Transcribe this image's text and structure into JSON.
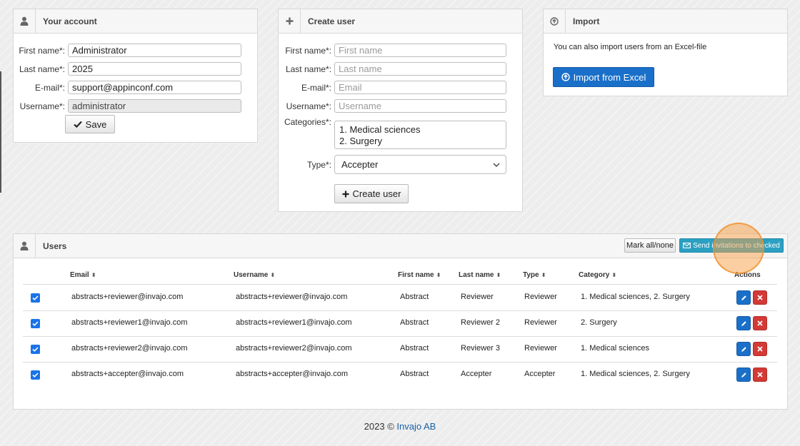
{
  "account": {
    "title": "Your account",
    "icon": "user-icon",
    "fields": [
      {
        "label": "First name*:",
        "value": "Administrator"
      },
      {
        "label": "Last name*:",
        "value": "2025"
      },
      {
        "label": "E-mail*:",
        "value": "support@appinconf.com"
      },
      {
        "label": "Username*:",
        "value": "administrator"
      }
    ],
    "save_label": "Save"
  },
  "create_user": {
    "title": "Create user",
    "icon": "plus-icon",
    "fields": [
      {
        "label": "First name*:",
        "placeholder": "First name"
      },
      {
        "label": "Last name*:",
        "placeholder": "Last name"
      },
      {
        "label": "E-mail*:",
        "placeholder": "Email"
      },
      {
        "label": "Username*:",
        "placeholder": "Username"
      }
    ],
    "categories_label": "Categories*:",
    "categories": [
      "1. Medical sciences",
      "2. Surgery"
    ],
    "type_label": "Type*:",
    "type_value": "Accepter",
    "button_label": "Create user"
  },
  "import": {
    "title": "Import",
    "icon": "upload-circle-icon",
    "text": "You can also import users from an Excel-file",
    "button_label": "Import from Excel"
  },
  "users": {
    "title": "Users",
    "icon": "user-icon",
    "mark_all_label": "Mark all/none",
    "send_label": "Send invitations to checked",
    "columns": {
      "email": "Email",
      "username": "Username",
      "first_name": "First name",
      "last_name": "Last name",
      "type": "Type",
      "category": "Category",
      "actions": "Actions"
    },
    "rows": [
      {
        "email": "abstracts+reviewer@invajo.com",
        "username": "abstracts+reviewer@invajo.com",
        "first_name": "Abstract",
        "last_name": "Reviewer",
        "type": "Reviewer",
        "category": "1. Medical sciences, 2. Surgery",
        "checked": true
      },
      {
        "email": "abstracts+reviewer1@invajo.com",
        "username": "abstracts+reviewer1@invajo.com",
        "first_name": "Abstract",
        "last_name": "Reviewer 2",
        "type": "Reviewer",
        "category": "2. Surgery",
        "checked": true
      },
      {
        "email": "abstracts+reviewer2@invajo.com",
        "username": "abstracts+reviewer2@invajo.com",
        "first_name": "Abstract",
        "last_name": "Reviewer 3",
        "type": "Reviewer",
        "category": "1. Medical sciences",
        "checked": true
      },
      {
        "email": "abstracts+accepter@invajo.com",
        "username": "abstracts+accepter@invajo.com",
        "first_name": "Abstract",
        "last_name": "Accepter",
        "type": "Accepter",
        "category": "1. Medical sciences, 2. Surgery",
        "checked": true
      }
    ]
  },
  "footer": {
    "text": "2023 ©",
    "link": "Invajo AB"
  },
  "colors": {
    "primary": "#1a70c9",
    "info": "#2aa0c2",
    "danger": "#d33a36",
    "checkbox": "#1a73e8"
  }
}
